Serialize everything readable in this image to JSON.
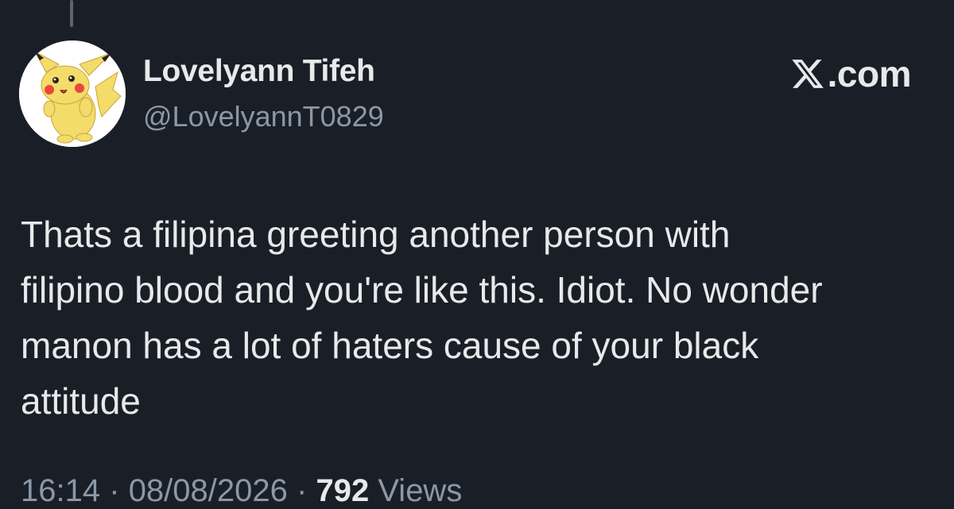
{
  "author": {
    "display_name": "Lovelyann Tifeh",
    "handle": "@LovelyannT0829",
    "avatar_icon": "pikachu-avatar"
  },
  "brand": {
    "icon": "x-logo-icon",
    "text": ".com"
  },
  "tweet": {
    "lines": [
      "Thats a filipina greeting another person with",
      "filipino blood and you're like this. Idiot. No wonder",
      "manon has a lot of haters cause of your black",
      "attitude"
    ]
  },
  "meta": {
    "time": "16:14",
    "date": "08/08/2026",
    "separator": "·",
    "views_count": "792",
    "views_label": "Views"
  },
  "colors": {
    "background": "#1a1f27",
    "primary_text": "#e7e9ea",
    "secondary_text": "#8b98a5"
  }
}
